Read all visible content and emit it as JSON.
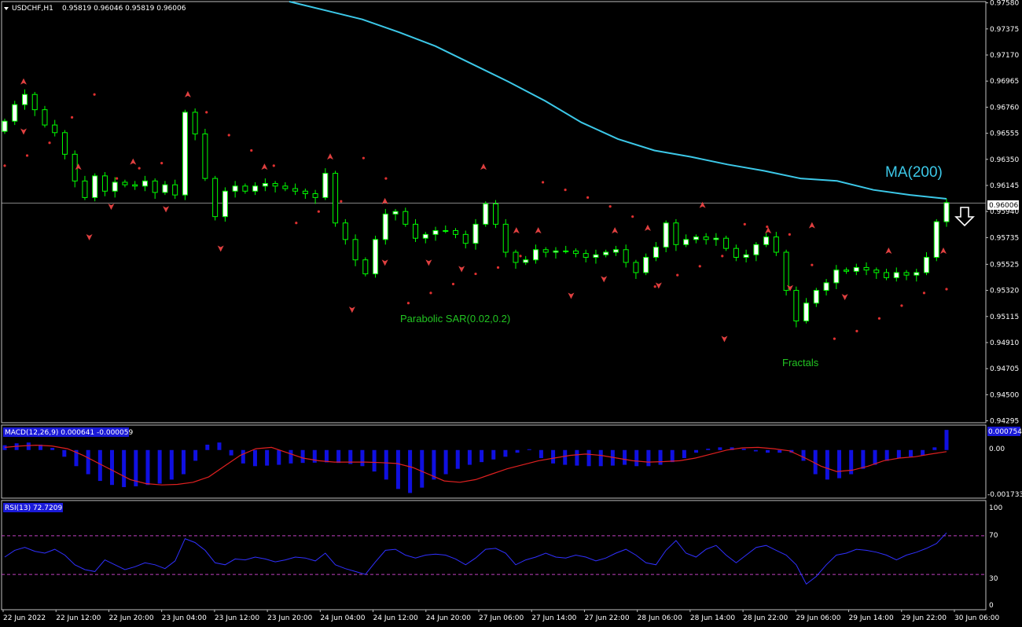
{
  "header": {
    "symbol": "USDCHF,H1",
    "ohlc": "0.95819 0.96046 0.95819 0.96006"
  },
  "colors": {
    "background": "#000000",
    "axis": "#c0c0c0",
    "bull_candle": "#ffffff",
    "candle_wick": "#00ff00",
    "ma": "#3cc8e8",
    "sar": "#e03030",
    "fractal": "#e04040",
    "macd_hist": "#1010e0",
    "macd_signal": "#e02020",
    "rsi": "#3030ff",
    "rsi_levels": "#c040c0",
    "annotation_green": "#22c422"
  },
  "annotations": {
    "ma": "MA(200)",
    "sar": "Parabolic SAR(0.02,0.2)",
    "fractals": "Fractals",
    "arrow": "down-arrow-icon"
  },
  "chart_data": [
    {
      "type": "candlestick",
      "title": "USDCHF,H1",
      "price_ticks": [
        "0.97580",
        "0.97375",
        "0.97170",
        "0.96965",
        "0.96760",
        "0.96555",
        "0.96350",
        "0.96145",
        "0.95940",
        "0.95735",
        "0.95525",
        "0.95320",
        "0.95115",
        "0.94910",
        "0.94705",
        "0.94500",
        "0.94295"
      ],
      "ylim": [
        0.9428,
        0.9759
      ],
      "current_price": "0.96006",
      "time_labels": [
        "22 Jun 2022",
        "22 Jun 12:00",
        "22 Jun 20:00",
        "23 Jun 04:00",
        "23 Jun 12:00",
        "23 Jun 20:00",
        "24 Jun 04:00",
        "24 Jun 12:00",
        "24 Jun 20:00",
        "27 Jun 06:00",
        "27 Jun 14:00",
        "27 Jun 22:00",
        "28 Jun 06:00",
        "28 Jun 14:00",
        "28 Jun 22:00",
        "29 Jun 06:00",
        "29 Jun 14:00",
        "29 Jun 22:00",
        "30 Jun 06:00"
      ],
      "close": [
        0.9665,
        0.9678,
        0.9686,
        0.9674,
        0.9662,
        0.9656,
        0.9639,
        0.9618,
        0.9605,
        0.9622,
        0.961,
        0.9617,
        0.9615,
        0.9614,
        0.9618,
        0.9609,
        0.9615,
        0.9607,
        0.9672,
        0.9655,
        0.962,
        0.959,
        0.961,
        0.9614,
        0.961,
        0.9614,
        0.9616,
        0.9614,
        0.9612,
        0.961,
        0.9608,
        0.9605,
        0.9624,
        0.9585,
        0.9572,
        0.9556,
        0.9545,
        0.9572,
        0.9592,
        0.9594,
        0.9584,
        0.9573,
        0.9576,
        0.9579,
        0.9579,
        0.9576,
        0.9569,
        0.9584,
        0.96,
        0.9584,
        0.9562,
        0.9554,
        0.9556,
        0.9564,
        0.9562,
        0.9563,
        0.9563,
        0.9561,
        0.9558,
        0.956,
        0.9562,
        0.9564,
        0.9554,
        0.9546,
        0.9558,
        0.9566,
        0.9585,
        0.9568,
        0.9572,
        0.9574,
        0.9572,
        0.9573,
        0.9565,
        0.9558,
        0.956,
        0.9568,
        0.9574,
        0.9562,
        0.9532,
        0.9508,
        0.9522,
        0.9532,
        0.9538,
        0.9548,
        0.9547,
        0.955,
        0.9548,
        0.9546,
        0.9542,
        0.9546,
        0.9544,
        0.9546,
        0.9558,
        0.9586,
        0.9601
      ],
      "ma200": [
        0.9759,
        0.9752,
        0.9745,
        0.9735,
        0.9724,
        0.971,
        0.9696,
        0.9681,
        0.9664,
        0.9651,
        0.9642,
        0.9637,
        0.9631,
        0.9626,
        0.962,
        0.9618,
        0.9611,
        0.9607,
        0.9604
      ],
      "sar": [
        0.963,
        0.9638,
        0.9648,
        0.9668,
        0.9686,
        0.962,
        0.9628,
        0.9632,
        0.9659,
        0.9672,
        0.9654,
        0.9642,
        0.963,
        0.9585,
        0.9594,
        0.9602,
        0.9636,
        0.962,
        0.9522,
        0.953,
        0.9537,
        0.9545,
        0.955,
        0.9559,
        0.9617,
        0.9611,
        0.9605,
        0.9598,
        0.959,
        0.9535,
        0.9544,
        0.9551,
        0.9559,
        0.9584,
        0.9582,
        0.9576,
        0.9552,
        0.9494,
        0.95,
        0.951,
        0.952,
        0.953,
        0.9533
      ],
      "fractals_up": [
        [
          0,
          0.9695
        ],
        [
          5,
          0.9628
        ],
        [
          10,
          0.9632
        ],
        [
          15,
          0.9685
        ],
        [
          22,
          0.9628
        ],
        [
          28,
          0.9636
        ],
        [
          33,
          0.9601
        ],
        [
          42,
          0.9628
        ],
        [
          45,
          0.9578
        ],
        [
          47,
          0.9578
        ],
        [
          54,
          0.9578
        ],
        [
          57,
          0.958
        ],
        [
          62,
          0.9598
        ],
        [
          68,
          0.9578
        ],
        [
          72,
          0.9582
        ],
        [
          79,
          0.9562
        ],
        [
          84,
          0.9562
        ]
      ],
      "fractals_down": [
        [
          0,
          0.9658
        ],
        [
          6,
          0.9575
        ],
        [
          8,
          0.9599
        ],
        [
          13,
          0.9597
        ],
        [
          18,
          0.9566
        ],
        [
          30,
          0.9518
        ],
        [
          33,
          0.9555
        ],
        [
          37,
          0.9555
        ],
        [
          40,
          0.955
        ],
        [
          50,
          0.9529
        ],
        [
          53,
          0.9542
        ],
        [
          58,
          0.9537
        ],
        [
          64,
          0.9495
        ],
        [
          70,
          0.9535
        ],
        [
          75,
          0.9528
        ]
      ]
    },
    {
      "type": "bar",
      "title": "MACD(12,26,9) 0.000641 -0.000059",
      "y_ticks": [
        "0.000754",
        "0.00",
        "-0.001733"
      ],
      "ylim": [
        -0.001733,
        0.000754
      ],
      "hist": [
        0.00018,
        0.00025,
        0.00028,
        0.0002,
        8e-05,
        -0.00025,
        -0.0006,
        -0.0009,
        -0.00115,
        -0.0013,
        -0.00138,
        -0.00135,
        -0.0013,
        -0.00125,
        -0.0011,
        -0.0009,
        -0.0004,
        0.0002,
        0.00028,
        -0.0002,
        -0.0005,
        -0.0006,
        -0.00058,
        -0.00055,
        -0.0005,
        -0.00048,
        -0.00047,
        -0.00046,
        -0.00048,
        -0.00052,
        -0.0006,
        -0.0008,
        -0.0011,
        -0.00145,
        -0.0016,
        -0.0014,
        -0.0011,
        -0.0009,
        -0.0007,
        -0.00055,
        -0.00045,
        -0.00035,
        -0.00025,
        -0.0001,
        3e-05,
        -0.0003,
        -0.0005,
        -0.00055,
        -0.00058,
        -0.0006,
        -0.0006,
        -0.00058,
        -0.00055,
        -0.0006,
        -0.0006,
        -0.00055,
        -0.00045,
        -0.0003,
        -0.0001,
        5e-05,
        0.0001,
        0.0001,
        5e-05,
        -5e-05,
        -0.0001,
        -0.0001,
        -0.0001,
        -0.0004,
        -0.0009,
        -0.0011,
        -0.00105,
        -0.0009,
        -0.0007,
        -0.00055,
        -0.0004,
        -0.0003,
        -0.00025,
        -0.0002,
        0.0001,
        0.00075
      ],
      "signal": [
        0.0001,
        0.00015,
        0.00018,
        0.00015,
        5e-05,
        -0.0002,
        -0.0005,
        -0.0008,
        -0.0011,
        -0.00125,
        -0.0013,
        -0.00128,
        -0.0012,
        -0.001,
        -0.0006,
        -0.0002,
        5e-05,
        0.0001,
        -0.0001,
        -0.0003,
        -0.0004,
        -0.00045,
        -0.00045,
        -0.00045,
        -0.00047,
        -0.0005,
        -0.00065,
        -0.0009,
        -0.00115,
        -0.0012,
        -0.0011,
        -0.0009,
        -0.0007,
        -0.00055,
        -0.0004,
        -0.0003,
        -0.0002,
        -0.00015,
        -0.0002,
        -0.0003,
        -0.0004,
        -0.00045,
        -0.00043,
        -0.0004,
        -0.0003,
        -0.00015,
        0.0,
        8e-05,
        0.0001,
        5e-05,
        -3e-05,
        -0.0003,
        -0.0006,
        -0.0008,
        -0.00075,
        -0.0006,
        -0.0004,
        -0.0003,
        -0.00025,
        -0.00015,
        -6e-05
      ]
    },
    {
      "type": "line",
      "title": "RSI(13) 72.7209",
      "y_ticks": [
        "100",
        "70",
        "30",
        "0"
      ],
      "ylim": [
        0,
        100
      ],
      "levels": [
        70,
        30
      ],
      "values": [
        48,
        55,
        58,
        54,
        52,
        56,
        50,
        40,
        35,
        33,
        45,
        40,
        35,
        38,
        42,
        40,
        36,
        44,
        67,
        63,
        55,
        42,
        40,
        46,
        45,
        48,
        46,
        43,
        45,
        48,
        47,
        44,
        52,
        40,
        36,
        33,
        30,
        43,
        55,
        56,
        50,
        47,
        50,
        51,
        50,
        46,
        40,
        47,
        56,
        57,
        52,
        40,
        45,
        48,
        52,
        48,
        47,
        50,
        48,
        44,
        47,
        52,
        56,
        50,
        42,
        40,
        55,
        65,
        52,
        48,
        56,
        60,
        50,
        42,
        50,
        58,
        60,
        55,
        50,
        40,
        20,
        28,
        40,
        50,
        52,
        56,
        55,
        53,
        50,
        45,
        50,
        53,
        57,
        62,
        73
      ]
    }
  ]
}
